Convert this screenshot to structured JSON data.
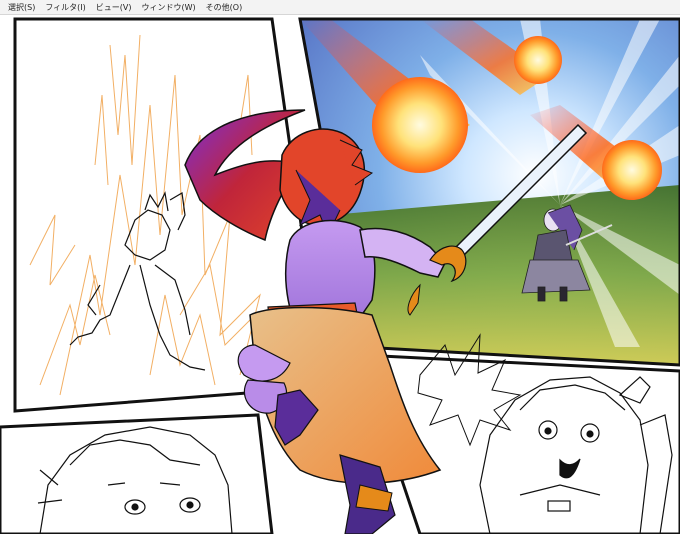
{
  "menubar": {
    "items": [
      {
        "label": "選択(S)"
      },
      {
        "label": "フィルタ(I)"
      },
      {
        "label": "ビュー(V)"
      },
      {
        "label": "ウィンドウ(W)"
      },
      {
        "label": "その他(O)"
      }
    ]
  },
  "canvas": {
    "description_colors": {
      "panel_border": "#111111",
      "sketch_orange": "#f0a24a",
      "dress_purple": "#b98ce8",
      "hair_red": "#e2452a",
      "explosion_yellow": "#ffe27a",
      "ground_green": "#5f8d2e"
    }
  }
}
